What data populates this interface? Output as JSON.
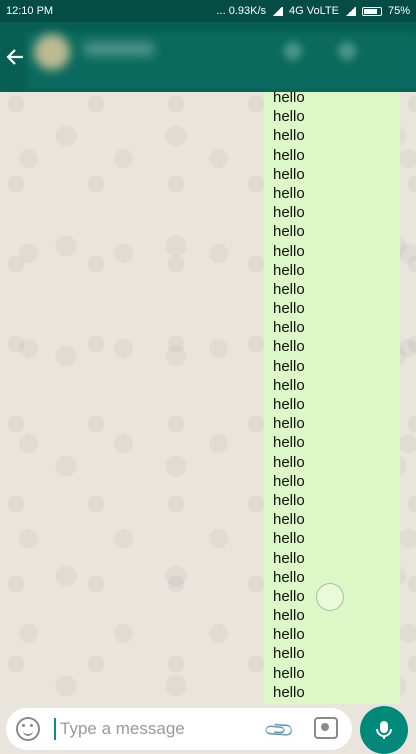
{
  "status_bar": {
    "time": "12:10 PM",
    "speed": "... 0.93K/s",
    "network": "4G VoLTE",
    "battery": "75%"
  },
  "header": {
    "back_icon": "arrow-left-icon"
  },
  "chat": {
    "messages": [
      "hello",
      "hello",
      "hello",
      "hello",
      "hello",
      "hello",
      "hello",
      "hello",
      "hello",
      "hello",
      "hello",
      "hello",
      "hello",
      "hello",
      "hello",
      "hello",
      "hello",
      "hello",
      "hello",
      "hello",
      "hello",
      "hello",
      "hello",
      "hello",
      "hello",
      "hello",
      "hello",
      "hello",
      "hello",
      "hello",
      "hello",
      "hello"
    ],
    "bubble_color": "#dcf8c6"
  },
  "composer": {
    "placeholder": "Type a message",
    "emoji_icon": "emoji-icon",
    "attach_icon": "paperclip-icon",
    "camera_icon": "camera-icon",
    "mic_icon": "microphone-icon",
    "accent_color": "#00897b"
  }
}
